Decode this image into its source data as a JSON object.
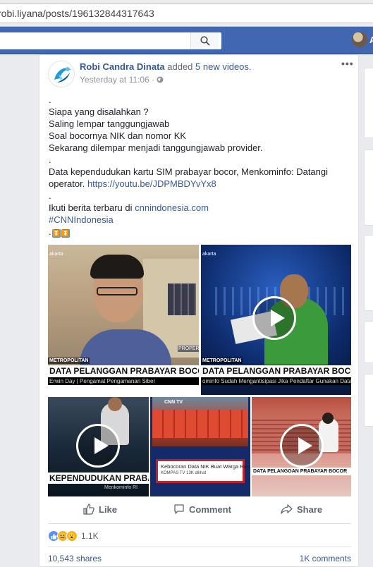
{
  "browser": {
    "url": "robi.liyana/posts/196132844317643"
  },
  "topbar": {
    "user_name": "A"
  },
  "post": {
    "author": "Robi Candra Dinata",
    "action": "added",
    "action_link": "5 new videos.",
    "timestamp": "Yesterday at 11:06 ·",
    "more_label": "•••",
    "lines": [
      ".",
      "Siapa yang disalahkan ?",
      "Saling lempar tanggungjawab",
      "Soal bocornya NIK dan nomor KK",
      "Sekarang dilempar menjadi tanggungjawab provider.",
      ".",
      "Data kependudukan kartu SIM prabayar bocor, Menkominfo: Datangi",
      "operator."
    ],
    "youtube_link": "https://youtu.be/JDPMBDYvYx8",
    "dot2": ".",
    "follow_text": "Ikuti berita terbaru di ",
    "follow_link": "cnnindonesia.com",
    "hashtag": "#CNNIndonesia",
    "final": "."
  },
  "videos": [
    {
      "top": "akarta",
      "lower": "DATA PELANGGAN PRABAYAR BOCOR",
      "sub": "Erwin Day | Pengamat Pengamanan Siber",
      "brand": "METROPOLITAN",
      "tag": "PROPERT"
    },
    {
      "top": "akarta",
      "lower": "DATA PELANGGAN PRABAYAR BOCOR",
      "sub": "ominfo Sudah Mengantisipasi Jika Pendaftar Gunakan Data Lain",
      "brand": "METROPOLITAN"
    },
    {
      "lower": "KEPENDUDUKAN PRABAYAR BOC",
      "sub": "Menkominfo RI"
    },
    {
      "headline": "Kebocoran Data NIK Buat Warga Resah",
      "meta": "KOMPAS TV   13K dilihat",
      "brand": "CNN TV"
    },
    {
      "lower": "DATA PELANGGAN PRABAYAR BOCOR"
    }
  ],
  "actions": {
    "like": "Like",
    "comment": "Comment",
    "share": "Share"
  },
  "stats": {
    "reactions": "1.1K",
    "shares": "10,543 shares",
    "comments": "1K comments"
  },
  "colors": {
    "fb_blue": "#4267b2",
    "link": "#365899"
  }
}
